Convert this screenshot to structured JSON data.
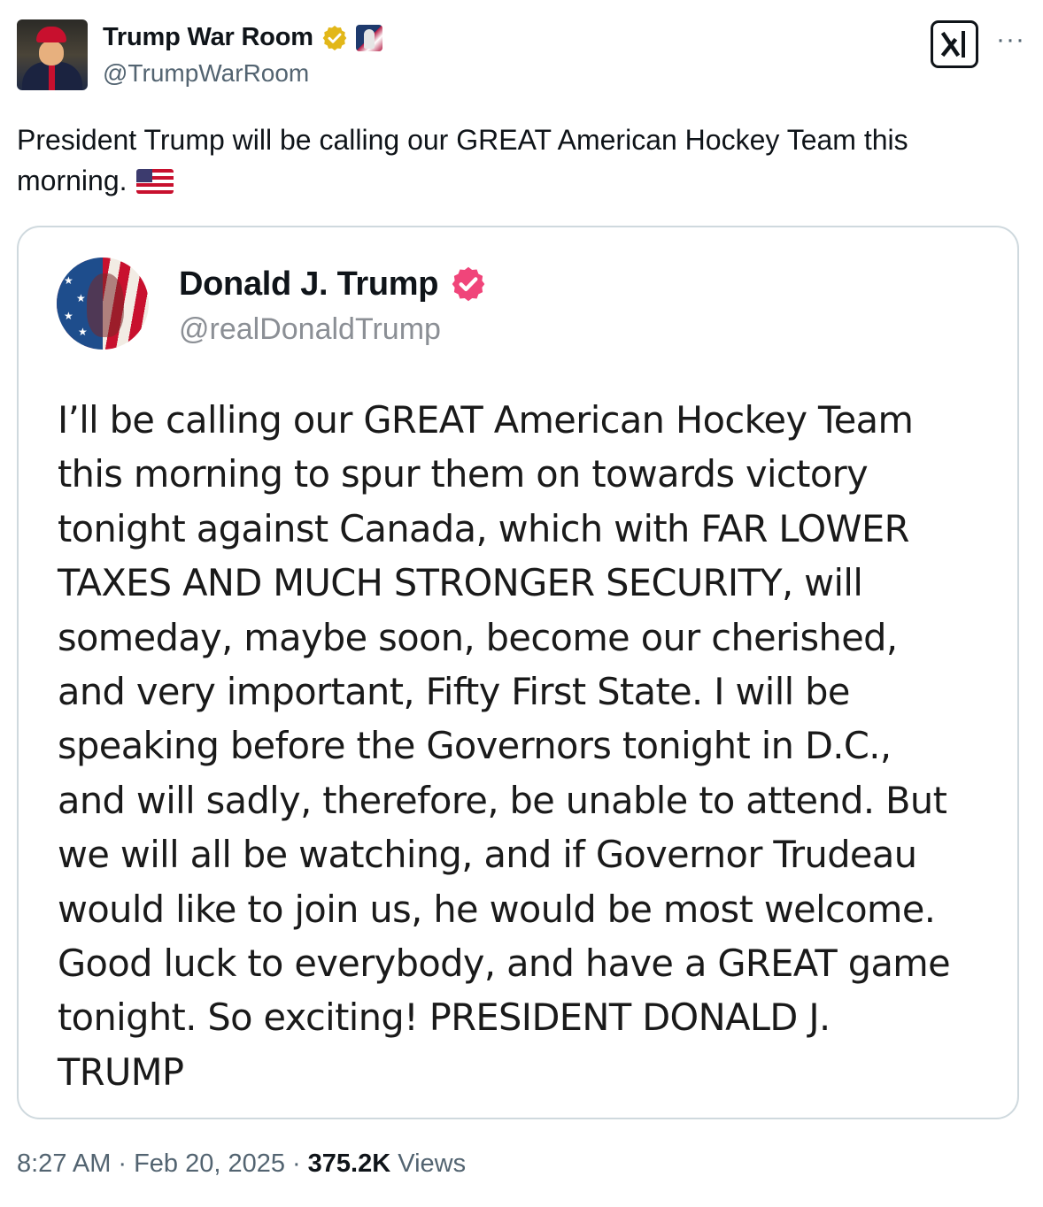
{
  "post": {
    "author": {
      "display_name": "Trump War Room",
      "handle": "@TrumpWarRoom",
      "verified_badge": "gold-verified-badge-icon",
      "avatar_icon": "trump-maga-hat-avatar"
    },
    "text": "President Trump will be calling our GREAT American Hockey Team this morning.",
    "emoji": "us-flag-emoji",
    "quoted": {
      "author": {
        "display_name": "Donald J. Trump",
        "handle": "@realDonaldTrump",
        "verified_badge": "pink-verified-badge-icon"
      },
      "body": "I’ll be calling our GREAT American Hockey Team\nthis morning to spur them on towards victory\ntonight against Canada, which with FAR LOWER\nTAXES AND MUCH STRONGER SECURITY, will\nsomeday, maybe soon, become our cherished,\nand very important, Fifty First State. I will be\nspeaking before the Governors tonight in D.C.,\nand will sadly, therefore, be unable to attend. But\nwe will all be watching, and if Governor Trudeau\nwould like to join us, he would be most welcome.\nGood luck to everybody, and have a GREAT game\ntonight. So exciting! PRESIDENT DONALD J.\nTRUMP"
    },
    "meta": {
      "time": "8:27 AM",
      "separator": "·",
      "date": "Feb 20, 2025",
      "views_count": "375.2K",
      "views_label": "Views"
    }
  },
  "colors": {
    "text": "#0f1419",
    "secondary": "#536471",
    "border": "#cfd9de",
    "gold_badge": "#e2b719",
    "pink_badge": "#f0457a"
  },
  "toolbar": {
    "x_logo": "x-grok-logo-icon",
    "more": "···"
  }
}
